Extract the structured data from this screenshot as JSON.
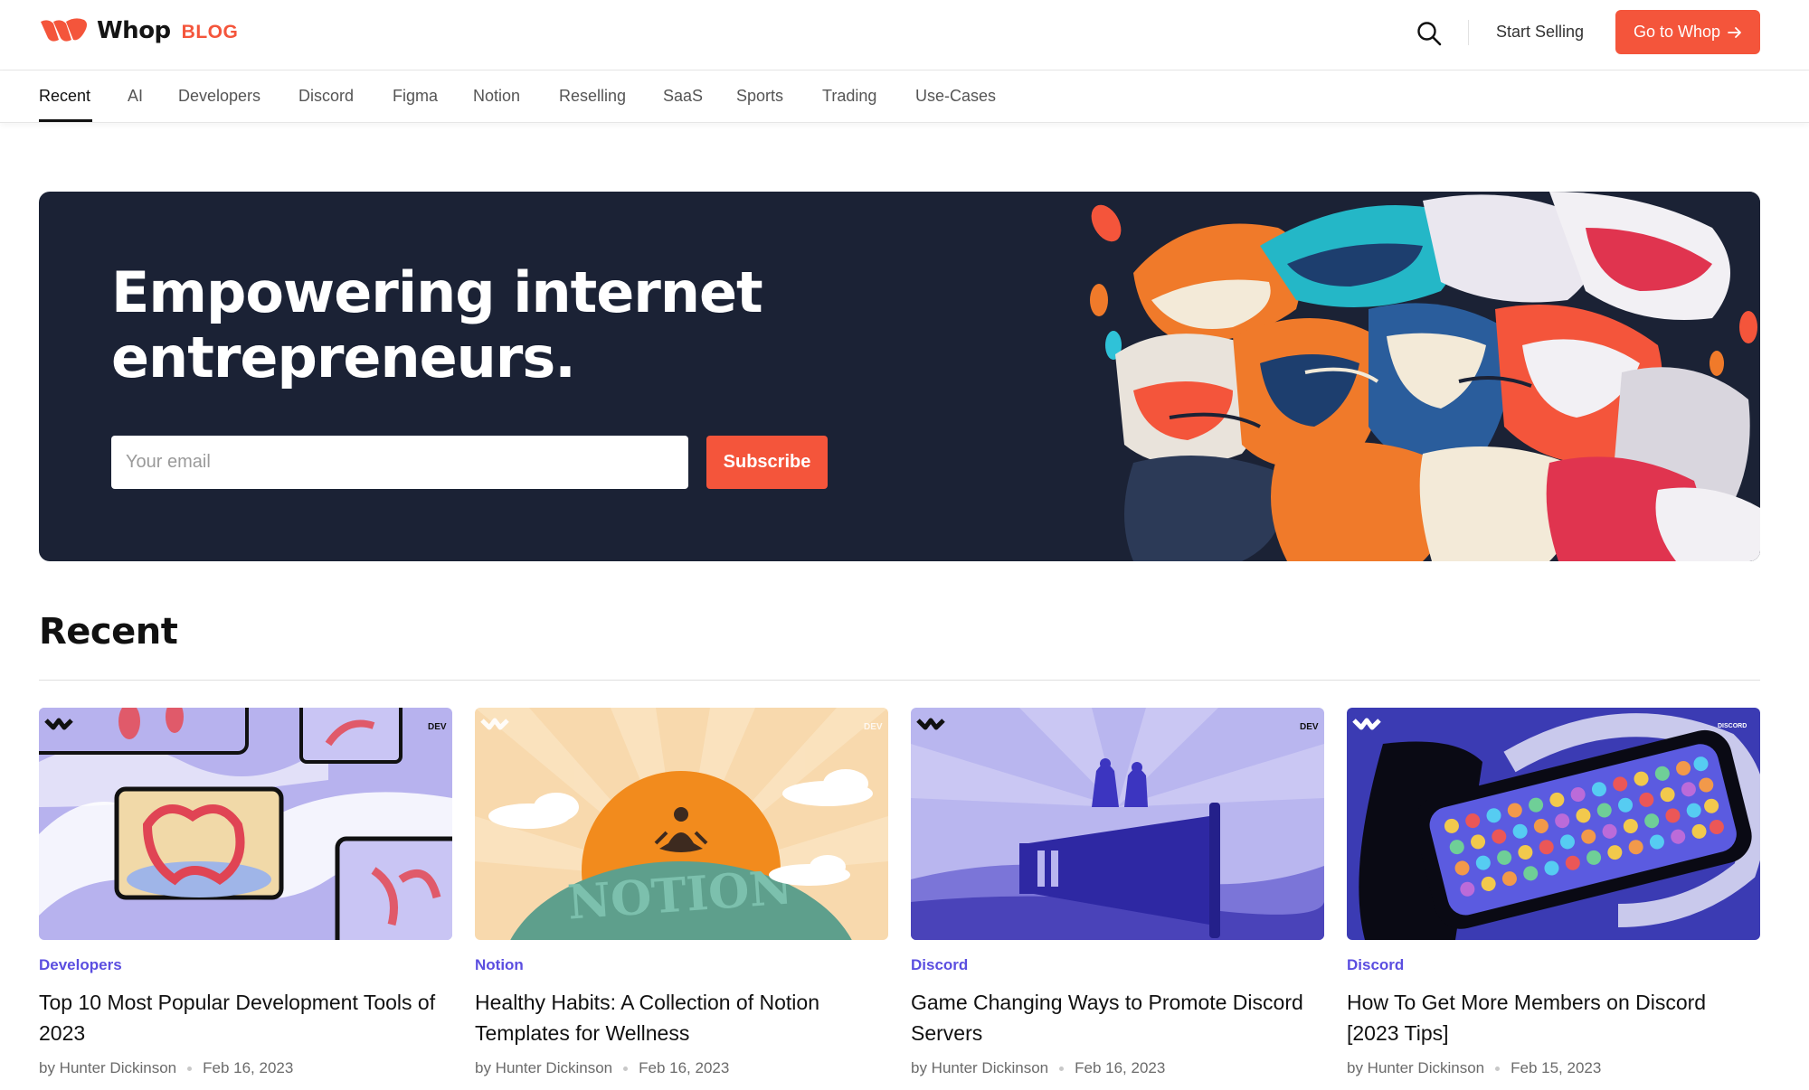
{
  "header": {
    "logo_text": "Whop",
    "logo_badge": "BLOG",
    "start_selling": "Start Selling",
    "go_to_whop": "Go to Whop",
    "accent_color": "#f4553b"
  },
  "categories": [
    {
      "label": "Recent",
      "active": true
    },
    {
      "label": "AI"
    },
    {
      "label": "Developers"
    },
    {
      "label": "Discord"
    },
    {
      "label": "Figma"
    },
    {
      "label": "Notion"
    },
    {
      "label": "Reselling"
    },
    {
      "label": "SaaS"
    },
    {
      "label": "Sports"
    },
    {
      "label": "Trading"
    },
    {
      "label": "Use-Cases"
    }
  ],
  "hero": {
    "title": "Empowering internet\nentrepreneurs.",
    "email_placeholder": "Your email",
    "subscribe_label": "Subscribe",
    "background": "#1b2235"
  },
  "recent": {
    "heading": "Recent",
    "posts": [
      {
        "category": "Developers",
        "title": "Top 10 Most Popular Development Tools of 2023",
        "author": "by Hunter Dickinson",
        "date": "Feb 16, 2023",
        "thumb_tag": "DEV"
      },
      {
        "category": "Notion",
        "title": "Healthy Habits: A Collection of Notion Templates for Wellness",
        "author": "by Hunter Dickinson",
        "date": "Feb 16, 2023",
        "thumb_tag": "DEV",
        "thumb_text": "NOTION"
      },
      {
        "category": "Discord",
        "title": "Game Changing Ways to Promote Discord Servers",
        "author": "by Hunter Dickinson",
        "date": "Feb 16, 2023",
        "thumb_tag": "DEV"
      },
      {
        "category": "Discord",
        "title": "How To Get More Members on Discord [2023 Tips]",
        "author": "by Hunter Dickinson",
        "date": "Feb 15, 2023",
        "thumb_tag": "DISCORD"
      }
    ]
  },
  "icons": {
    "search": "search-icon",
    "arrow": "arrow-right-icon",
    "logo": "whop-logo-icon"
  }
}
